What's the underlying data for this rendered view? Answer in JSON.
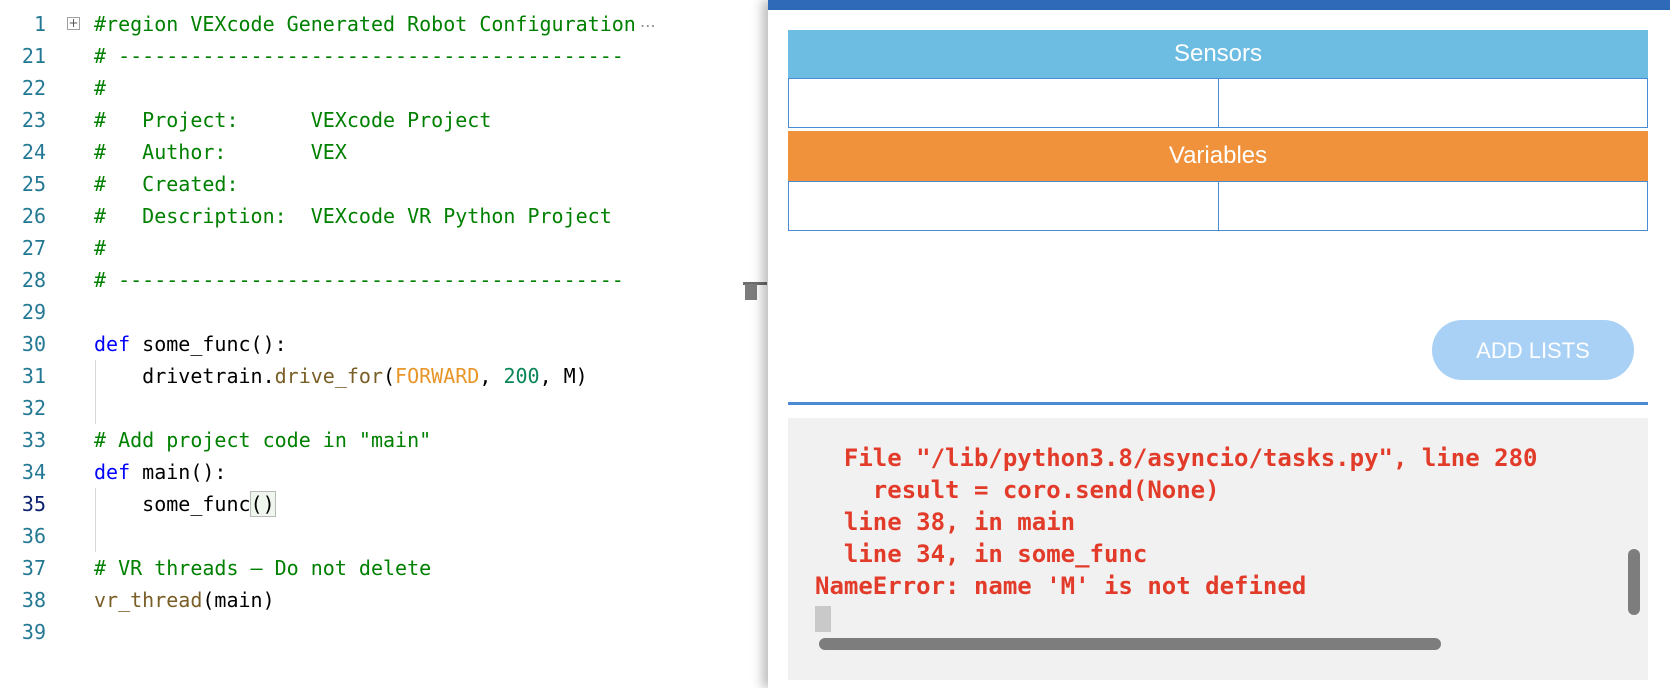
{
  "editor": {
    "lines": [
      {
        "num": "1",
        "tokens": [
          {
            "t": "#region VEXcode Generated Robot Configuration",
            "c": "t-region"
          }
        ],
        "fold": true
      },
      {
        "num": "21",
        "tokens": [
          {
            "t": "# ------------------------------------------",
            "c": "t-comment"
          }
        ]
      },
      {
        "num": "22",
        "tokens": [
          {
            "t": "#",
            "c": "t-comment"
          }
        ]
      },
      {
        "num": "23",
        "tokens": [
          {
            "t": "#   Project:      VEXcode Project",
            "c": "t-comment"
          }
        ]
      },
      {
        "num": "24",
        "tokens": [
          {
            "t": "#   Author:       VEX",
            "c": "t-comment"
          }
        ]
      },
      {
        "num": "25",
        "tokens": [
          {
            "t": "#   Created:",
            "c": "t-comment"
          }
        ]
      },
      {
        "num": "26",
        "tokens": [
          {
            "t": "#   Description:  VEXcode VR Python Project",
            "c": "t-comment"
          }
        ]
      },
      {
        "num": "27",
        "tokens": [
          {
            "t": "#",
            "c": "t-comment"
          }
        ]
      },
      {
        "num": "28",
        "tokens": [
          {
            "t": "# ------------------------------------------",
            "c": "t-comment"
          }
        ]
      },
      {
        "num": "29",
        "tokens": []
      },
      {
        "num": "30",
        "tokens": [
          {
            "t": "def",
            "c": "t-kw"
          },
          {
            "t": " some_func():",
            "c": "t-plain"
          }
        ]
      },
      {
        "num": "31",
        "tokens": [
          {
            "t": "    drivetrain.",
            "c": "t-plain"
          },
          {
            "t": "drive_for",
            "c": "t-fn"
          },
          {
            "t": "(",
            "c": "t-plain"
          },
          {
            "t": "FORWARD",
            "c": "t-const"
          },
          {
            "t": ", ",
            "c": "t-plain"
          },
          {
            "t": "200",
            "c": "t-num"
          },
          {
            "t": ", M)",
            "c": "t-plain"
          }
        ]
      },
      {
        "num": "32",
        "tokens": []
      },
      {
        "num": "33",
        "tokens": [
          {
            "t": "# Add project code in \"main\"",
            "c": "t-comment"
          }
        ]
      },
      {
        "num": "34",
        "tokens": [
          {
            "t": "def",
            "c": "t-kw"
          },
          {
            "t": " main():",
            "c": "t-plain"
          }
        ]
      },
      {
        "num": "35",
        "tokens": [
          {
            "t": "    some_func",
            "c": "t-plain"
          },
          {
            "t": "()",
            "c": "t-plain bracket"
          }
        ],
        "active": true
      },
      {
        "num": "36",
        "tokens": []
      },
      {
        "num": "37",
        "tokens": [
          {
            "t": "# VR threads — Do not delete",
            "c": "t-comment"
          }
        ]
      },
      {
        "num": "38",
        "tokens": [
          {
            "t": "vr_thread",
            "c": "t-fn"
          },
          {
            "t": "(main)",
            "c": "t-plain"
          }
        ]
      },
      {
        "num": "39",
        "tokens": []
      }
    ],
    "fold_ellipsis": "⋯"
  },
  "panel": {
    "sensors_title": "Sensors",
    "variables_title": "Variables",
    "add_lists_label": "ADD LISTS"
  },
  "console": {
    "lines": [
      "  File \"/lib/python3.8/asyncio/tasks.py\", line 280",
      "    result = coro.send(None)",
      "  line 38, in main",
      "  line 34, in some_func",
      "NameError: name 'M' is not defined"
    ]
  },
  "colors": {
    "sensors": "#6dbde3",
    "variables": "#f0923b",
    "error": "#e23b2a",
    "add_lists": "#a9d0f5"
  }
}
